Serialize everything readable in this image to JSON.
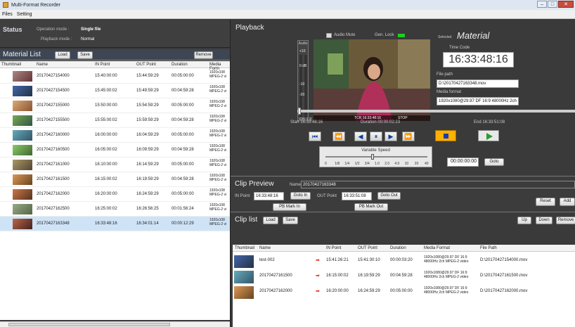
{
  "window": {
    "title": "Multi-Format Recorder"
  },
  "menu": [
    "Files",
    "Setting"
  ],
  "status": {
    "heading": "Status",
    "operation_label": "Operation mode :",
    "operation_value": "Single file",
    "playback_label": "Playback mode :",
    "playback_value": "Normal"
  },
  "material_list": {
    "heading": "Material List",
    "load": "Load",
    "save": "Save",
    "remove": "Remove",
    "columns": [
      "Thumbnail",
      "Name",
      "IN Point",
      "OUT Point",
      "Duration",
      "Media Form"
    ],
    "rows": [
      {
        "name": "20170427154000",
        "in": "15:40:00:00",
        "out": "15:44:59:29",
        "dur": "00:05:00:00",
        "media": "1920x108\nMPEG-2 vi"
      },
      {
        "name": "20170427154500",
        "in": "15:45:00:02",
        "out": "15:49:59:29",
        "dur": "00:04:59:28",
        "media": "1920x108\nMPEG-2 vi"
      },
      {
        "name": "20170427155000",
        "in": "15:50:00:00",
        "out": "15:54:59:29",
        "dur": "00:05:00:00",
        "media": "1920x108\nMPEG-2 vi"
      },
      {
        "name": "20170427155500",
        "in": "15:55:00:02",
        "out": "15:59:59:29",
        "dur": "00:04:59:28",
        "media": "1920x108\nMPEG-2 vi"
      },
      {
        "name": "20170427160000",
        "in": "16:00:00:00",
        "out": "16:04:59:29",
        "dur": "00:05:00:00",
        "media": "1920x108\nMPEG-2 vi"
      },
      {
        "name": "20170427160500",
        "in": "16:05:00:02",
        "out": "16:09:59:29",
        "dur": "00:04:59:28",
        "media": "1920x108\nMPEG-2 vi"
      },
      {
        "name": "20170427161000",
        "in": "16:10:00:00",
        "out": "16:14:59:29",
        "dur": "00:05:00:00",
        "media": "1920x108\nMPEG-2 vi"
      },
      {
        "name": "20170427161500",
        "in": "16:15:00:02",
        "out": "16:19:59:29",
        "dur": "00:04:59:28",
        "media": "1920x108\nMPEG-2 vi"
      },
      {
        "name": "20170427162000",
        "in": "16:20:00:00",
        "out": "16:24:59:29",
        "dur": "00:05:00:00",
        "media": "1920x108\nMPEG-2 vi"
      },
      {
        "name": "20170427162500",
        "in": "16:25:00:02",
        "out": "16:26:56:25",
        "dur": "00:01:56:24",
        "media": "1920x108\nMPEG-2 vi"
      },
      {
        "name": "20170427163348",
        "in": "16:33:48:16",
        "out": "16:34:01:14",
        "dur": "00:00:12:29",
        "media": "1920x108\nMPEG-2 vi"
      }
    ]
  },
  "playback": {
    "heading": "Playback",
    "audio_mute": "Audio Mute",
    "gen_lock": "Gen. Lock",
    "audio": "Audio",
    "audio_scale": [
      "+10",
      "0 dB",
      "-10",
      "-20"
    ],
    "channel": "CH. 1 2",
    "tcr": "TCR 16:33:48:16",
    "state": "STOP",
    "selected_label": "Selected",
    "selected_value": "Material",
    "timecode_label": "Time Code",
    "timecode": "16:33:48:16",
    "filepath_label": "File path",
    "filepath": "D:\\20170427163348.mov",
    "mediaformat_label": "Media format",
    "mediaformat": "1920x1080@29.97 DF 16:9 48000Hz 2ch",
    "start_label": "Start",
    "start": "16:33:48:16",
    "duration_label": "Duration",
    "duration": "00:00:02:23",
    "end_label": "End",
    "end": "16:33:51:08",
    "speed_label": "Variable Speed",
    "speed_ticks": [
      "0",
      "1/8",
      "1/4",
      "1/2",
      "3/4",
      "1.0",
      "2.0",
      "4.0",
      "10",
      "20",
      "40"
    ],
    "goto_tc": "00:00:00:00",
    "goto": "Goto"
  },
  "clip_preview": {
    "heading": "Clip Preview",
    "name_label": "Name",
    "name": "20170427163348",
    "in_label": "IN Point",
    "in": "16:33:48:16",
    "goto_in": "Goto In",
    "out_label": "OUT Point",
    "out": "16:33:51:08",
    "goto_out": "Goto Out",
    "pb_mark_in": "PB Mark In",
    "pb_mark_out": "PB Mark Out",
    "reset": "Reset",
    "add": "Add"
  },
  "clip_list": {
    "heading": "Clip list",
    "load": "Load",
    "save": "Save",
    "up": "Up",
    "down": "Down",
    "remove": "Remove",
    "columns": [
      "Thumbnail",
      "Name",
      "IN Point",
      "OUT Point",
      "Duration",
      "Media Format",
      "File Path"
    ],
    "rows": [
      {
        "name": "test-002",
        "in": "15:41:26:21",
        "out": "15:41:30:10",
        "dur": "00:00:03:20",
        "media": "1920x1080@29.97 DF 16:9\n48000Hz 2ch MPEG-2 video",
        "path": "D:\\20170427154000.mov"
      },
      {
        "name": "20170427161500",
        "in": "16:15:00:02",
        "out": "16:19:59:29",
        "dur": "00:04:59:28",
        "media": "1920x1080@29.97 DF 16:9\n48000Hz 2ch MPEG-2 video",
        "path": "D:\\20170427161500.mov"
      },
      {
        "name": "20170427162000",
        "in": "16:20:00:00",
        "out": "16:24:59:29",
        "dur": "00:05:00:00",
        "media": "1920x1080@29.97 DF 16:9\n48000Hz 2ch MPEG-2 video",
        "path": "D:\\20170427162000.mov"
      }
    ]
  },
  "colors": {
    "accent": "#ffb000",
    "play": "#2a9d2a",
    "transport": "#1a3ea8",
    "genlock": "#22cc22"
  }
}
